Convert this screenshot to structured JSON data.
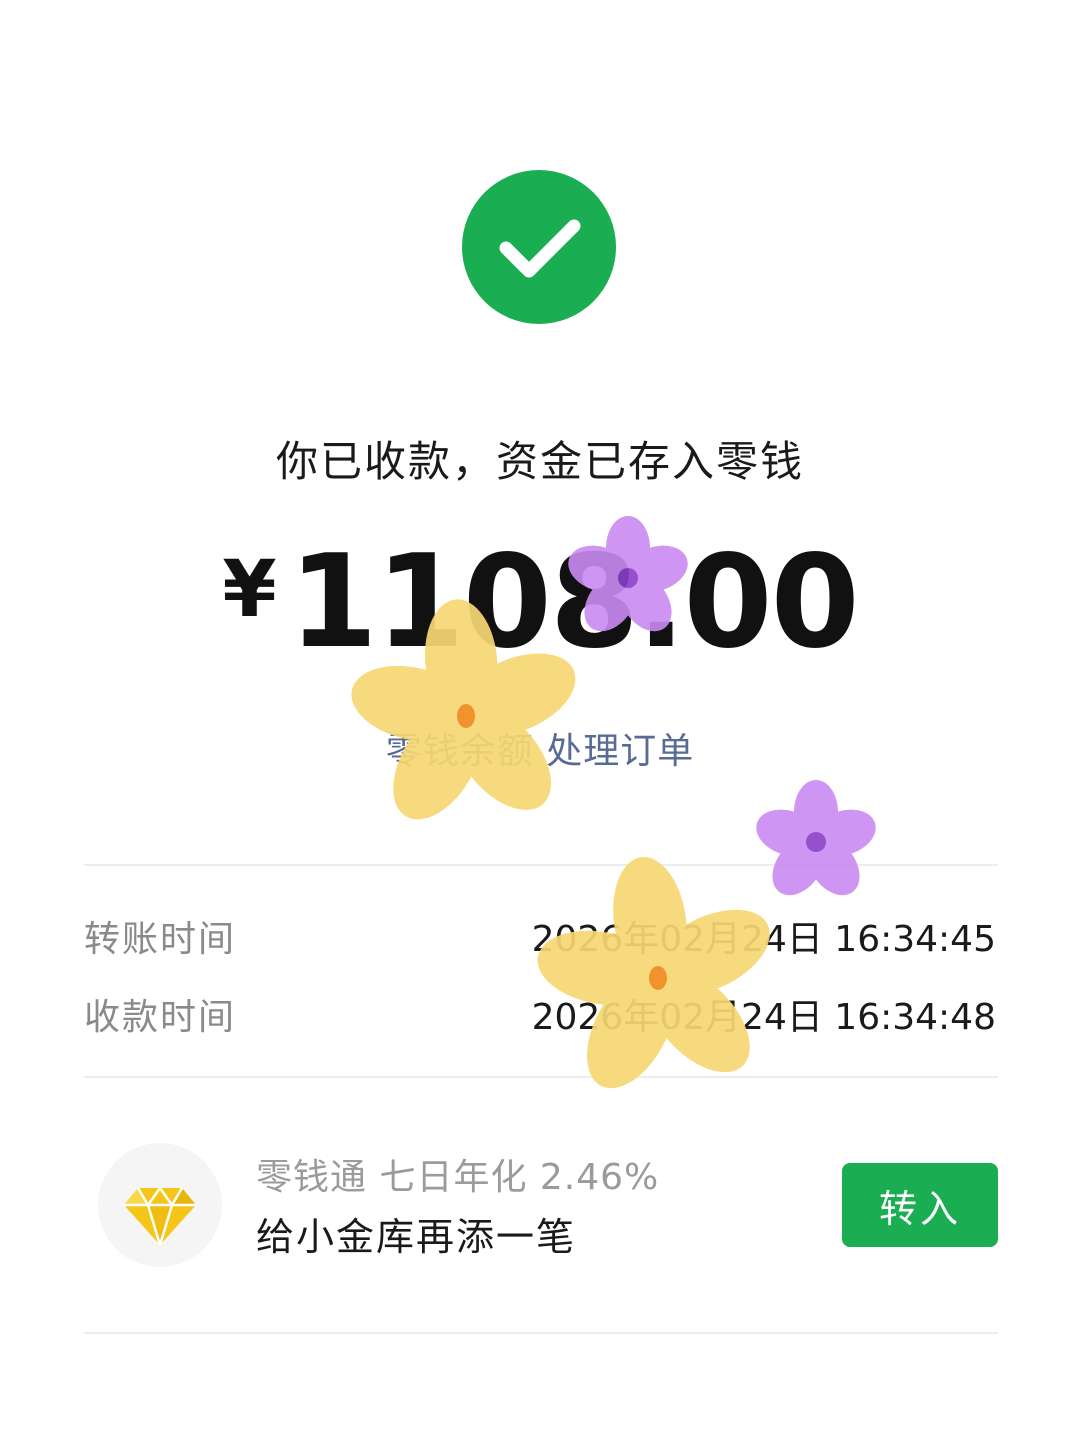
{
  "status": {
    "icon": "check-icon",
    "message": "你已收款，资金已存入零钱"
  },
  "amount": {
    "currency": "¥",
    "value": "1108.00"
  },
  "link": {
    "text": "零钱余额 处理订单"
  },
  "details": [
    {
      "label": "转账时间",
      "value": "2026年02月24日 16:34:45"
    },
    {
      "label": "收款时间",
      "value": "2026年02月24日 16:34:48"
    }
  ],
  "promo": {
    "icon": "diamond-icon",
    "subtitle": "零钱通 七日年化 2.46%",
    "title": "给小金库再添一笔",
    "button_label": "转入"
  },
  "colors": {
    "brand_green": "#1aad52",
    "link_blue": "#576b95",
    "diamond_gold": "#f5c518",
    "sticker_yellow": "#f7d774",
    "sticker_purple": "#c98af2"
  },
  "decorations": [
    "yellow-flower-sticker",
    "purple-flower-sticker"
  ]
}
